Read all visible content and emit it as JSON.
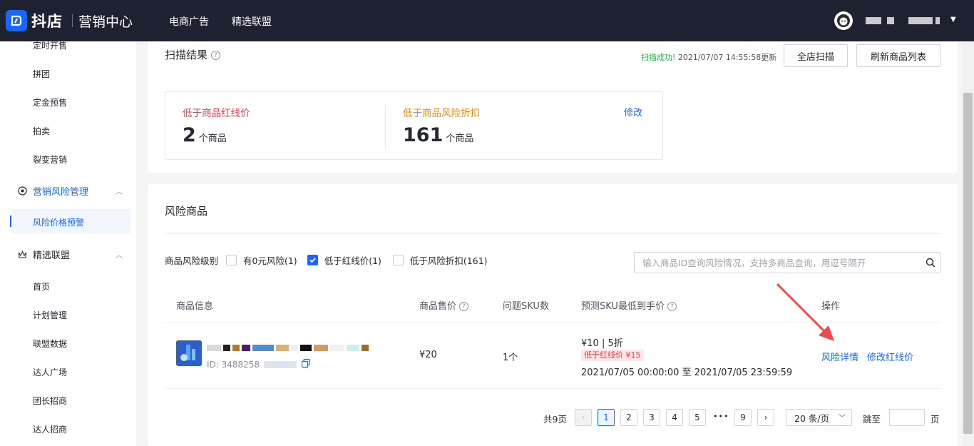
{
  "header": {
    "logo_text": "抖店",
    "logo_sub": "营销中心",
    "nav": [
      "电商广告",
      "精选联盟"
    ]
  },
  "sidebar": {
    "items_top": [
      "定时开售",
      "拼团",
      "定金预售",
      "拍卖",
      "裂变营销"
    ],
    "group_risk": "营销风险管理",
    "active_item": "风险价格预警",
    "group_alliance": "精选联盟",
    "alliance_items": [
      "首页",
      "计划管理",
      "联盟数据",
      "达人广场",
      "团长招商",
      "达人招商"
    ]
  },
  "scan": {
    "title": "扫描结果",
    "status_success": "扫描成功!",
    "status_time": "2021/07/07 14:55:58更新",
    "btn_full_scan": "全店扫描",
    "btn_refresh": "刷新商品列表",
    "stat1_label": "低于商品红线价",
    "stat1_value": "2",
    "stat1_unit": "个商品",
    "stat2_label": "低于商品风险折扣",
    "stat2_value": "161",
    "stat2_unit": "个商品",
    "edit_link": "修改"
  },
  "risk": {
    "title": "风险商品",
    "filter_label": "商品风险级别",
    "filters": [
      {
        "label": "有0元风险(1)",
        "checked": false
      },
      {
        "label": "低于红线价(1)",
        "checked": true
      },
      {
        "label": "低于风险折扣(161)",
        "checked": false
      }
    ],
    "search_placeholder": "输入商品ID查询风险情况，支持多商品查询，用逗号隔开",
    "columns": {
      "info": "商品信息",
      "price": "商品售价",
      "sku_count": "问题SKU数",
      "predict": "预测SKU最低到手价",
      "ops": "操作"
    },
    "row": {
      "id_prefix": "ID: 3488258",
      "price": "¥20",
      "sku_count": "1个",
      "predict_main": "¥10 | 5折",
      "predict_tag": "低于红线价 ¥15",
      "predict_time": "2021/07/05 00:00:00 至 2021/07/05 23:59:59",
      "op_detail": "风险详情",
      "op_edit": "修改红线价"
    }
  },
  "pagination": {
    "total": "共9页",
    "pages": [
      "1",
      "2",
      "3",
      "4",
      "5"
    ],
    "ellipsis": "•••",
    "last": "9",
    "per_page": "20 条/页",
    "jump_label": "跳至",
    "jump_suffix": "页"
  },
  "colors": {
    "brand": "#1966ff",
    "red": "#f2394a",
    "orange": "#ed8a0c",
    "success": "#23b23c"
  }
}
